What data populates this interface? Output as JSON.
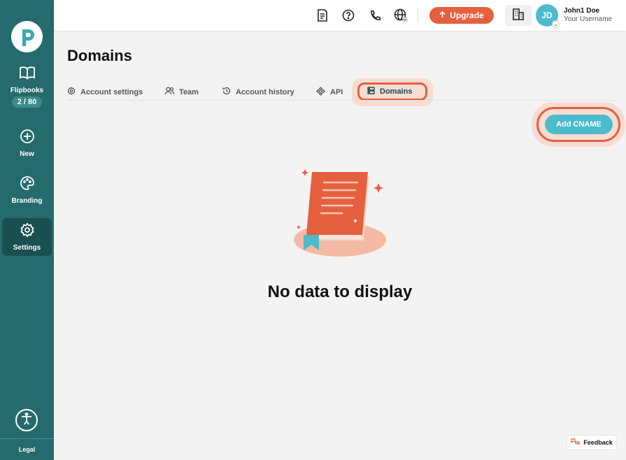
{
  "sidebar": {
    "logo_icon": "flipbook-logo-icon",
    "items": [
      {
        "label": "Flipbooks",
        "icon": "book-open-icon",
        "counter": "2 / 80"
      },
      {
        "label": "New",
        "icon": "plus-circle-icon"
      },
      {
        "label": "Branding",
        "icon": "palette-icon"
      },
      {
        "label": "Settings",
        "icon": "gear-icon",
        "active": true
      }
    ],
    "accessibility_icon": "accessibility-icon",
    "legal": "Legal"
  },
  "header": {
    "icons": [
      "document-icon",
      "help-icon",
      "phone-icon",
      "globe-icon"
    ],
    "upgrade_label": "Upgrade",
    "user": {
      "initials": "JD",
      "name": "John1 Doe",
      "username": "Your Username"
    }
  },
  "page": {
    "title": "Domains",
    "tabs": [
      {
        "label": "Account settings",
        "icon": "gear-icon"
      },
      {
        "label": "Team",
        "icon": "users-icon"
      },
      {
        "label": "Account history",
        "icon": "history-icon"
      },
      {
        "label": "API",
        "icon": "api-icon"
      },
      {
        "label": "Domains",
        "icon": "server-icon",
        "active": true
      }
    ],
    "add_button": "Add CNAME",
    "empty_message": "No data to display",
    "feedback": "Feedback"
  },
  "colors": {
    "sidebar": "#256b6e",
    "accent_orange": "#e4603e",
    "accent_teal": "#4bbccc",
    "highlight": "#f7dcd3"
  }
}
